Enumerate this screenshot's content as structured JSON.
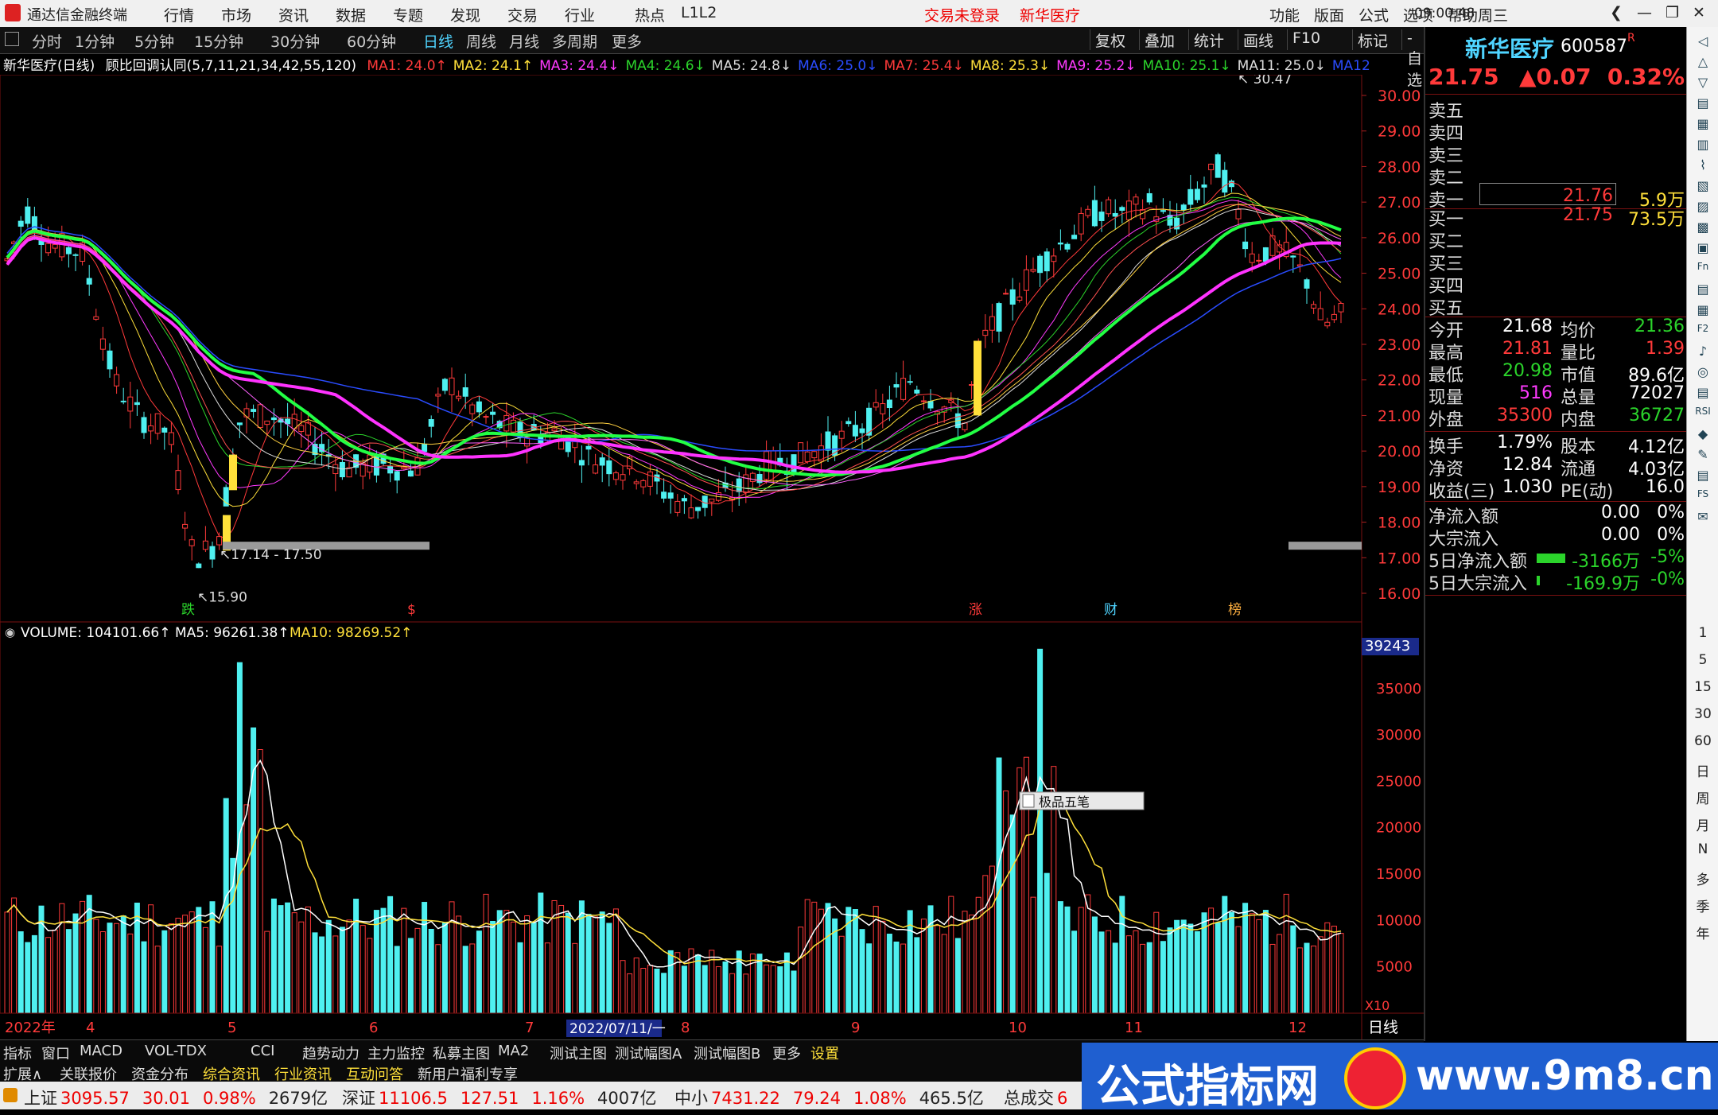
{
  "window": {
    "app_title": "通达信金融终端",
    "menu": [
      "行情",
      "市场",
      "资讯",
      "数据",
      "专题",
      "发现",
      "交易",
      "行业",
      "热点",
      "L1L2"
    ],
    "notice": "交易未登录",
    "stock_name_top": "新华医疗",
    "right_menu": [
      "功能",
      "版面",
      "公式",
      "选项",
      "帮助"
    ],
    "clock": "09:00:48",
    "weekday": "周三"
  },
  "periods": [
    "分时",
    "1分钟",
    "5分钟",
    "15分钟",
    "30分钟",
    "60分钟",
    "日线",
    "周线",
    "月线",
    "多周期",
    "更多"
  ],
  "active_period": "日线",
  "chart_tools": [
    "复权",
    "叠加",
    "统计",
    "画线",
    "F10",
    "标记",
    "-自选",
    "返回"
  ],
  "legend": {
    "title": "新华医疗(日线)",
    "indicator": "顾比回调认同(5,7,11,21,34,42,55,120)",
    "items": [
      {
        "text": "MA1: 24.0↑",
        "color": "#ff3a3a"
      },
      {
        "text": "MA2: 24.1↑",
        "color": "#ffe03a"
      },
      {
        "text": "MA3: 24.4↓",
        "color": "#ff3aff"
      },
      {
        "text": "MA4: 24.6↓",
        "color": "#2bd42b"
      },
      {
        "text": "MA5: 24.8↓",
        "color": "#dddddd"
      },
      {
        "text": "MA6: 25.0↓",
        "color": "#2a4cff"
      },
      {
        "text": "MA7: 25.4↓",
        "color": "#ff3a3a"
      },
      {
        "text": "MA8: 25.3↓",
        "color": "#ffe03a"
      },
      {
        "text": "MA9: 25.2↓",
        "color": "#ff3aff"
      },
      {
        "text": "MA10: 25.1↓",
        "color": "#2bd42b"
      },
      {
        "text": "MA11: 25.0↓",
        "color": "#dddddd"
      },
      {
        "text": "MA12",
        "color": "#2a4cff"
      }
    ]
  },
  "price_axis": [
    "30.00",
    "29.00",
    "28.00",
    "27.00",
    "26.00",
    "25.00",
    "24.00",
    "23.00",
    "22.00",
    "21.00",
    "20.00",
    "19.00",
    "18.00",
    "17.00",
    "16.00"
  ],
  "annotations": {
    "high_label": "30.47",
    "low_label": "15.90",
    "range_label": "17.14 - 17.50",
    "markers": [
      "跌",
      "$",
      "涨",
      "财",
      "榜"
    ]
  },
  "volume_legend": {
    "vol": "VOLUME: 104101.66↑",
    "ma5": "MA5: 96261.38↑",
    "ma10": "MA10: 98269.52↑"
  },
  "volume_axis": [
    "39243",
    "35000",
    "30000",
    "25000",
    "20000",
    "15000",
    "10000",
    "5000"
  ],
  "volume_unit": "X10",
  "popup_label": "极品五笔",
  "date_axis": [
    "2022年",
    "4",
    "5",
    "6",
    "7",
    "8",
    "9",
    "10",
    "11",
    "12"
  ],
  "date_cursor": "2022/07/11/一",
  "period_label": "日线",
  "bottom_tabs": [
    "指标",
    "窗口",
    "MACD",
    "VOL-TDX",
    "CCI",
    "趋势动力",
    "主力监控",
    "私募主图",
    "MA2",
    "测试主图",
    "测试幅图A",
    "测试幅图B",
    "更多",
    "设置"
  ],
  "bottom_tabs2": [
    "扩展∧",
    "关联报价",
    "资金分布",
    "综合资讯",
    "行业资讯",
    "互动问答",
    "新用户福利专享"
  ],
  "ticker": [
    {
      "name": "上证",
      "price": "3095.57",
      "chg": "30.01",
      "pct": "0.98%",
      "amt": "2679亿"
    },
    {
      "name": "深证",
      "price": "11106.5",
      "chg": "127.51",
      "pct": "1.16%",
      "amt": "4007亿"
    },
    {
      "name": "中小",
      "price": "7431.22",
      "chg": "79.24",
      "pct": "1.08%",
      "amt": "465.5亿"
    },
    {
      "name": "总成交",
      "price": "6",
      "chg": "",
      "pct": "",
      "amt": ""
    }
  ],
  "quote": {
    "name": "新华医疗",
    "code": "600587",
    "r_badge": "R",
    "price": "21.75",
    "change": "▲0.07",
    "pct": "0.32%",
    "asks": [
      {
        "label": "卖五",
        "price": "",
        "vol": ""
      },
      {
        "label": "卖四",
        "price": "",
        "vol": ""
      },
      {
        "label": "卖三",
        "price": "",
        "vol": ""
      },
      {
        "label": "卖二",
        "price": "",
        "vol": ""
      },
      {
        "label": "卖一",
        "price": "21.76",
        "vol": "5.9万"
      }
    ],
    "bids": [
      {
        "label": "买一",
        "price": "21.75",
        "vol": "73.5万"
      },
      {
        "label": "买二",
        "price": "",
        "vol": ""
      },
      {
        "label": "买三",
        "price": "",
        "vol": ""
      },
      {
        "label": "买四",
        "price": "",
        "vol": ""
      },
      {
        "label": "买五",
        "price": "",
        "vol": ""
      }
    ],
    "stats": [
      {
        "l1": "今开",
        "v1": "21.68",
        "c1": "white",
        "l2": "均价",
        "v2": "21.36",
        "c2": "green"
      },
      {
        "l1": "最高",
        "v1": "21.81",
        "c1": "red",
        "l2": "量比",
        "v2": "1.39",
        "c2": "red"
      },
      {
        "l1": "最低",
        "v1": "20.98",
        "c1": "green",
        "l2": "市值",
        "v2": "89.6亿",
        "c2": "white"
      },
      {
        "l1": "现量",
        "v1": "516",
        "c1": "mag",
        "l2": "总量",
        "v2": "72027",
        "c2": "white"
      },
      {
        "l1": "外盘",
        "v1": "35300",
        "c1": "red",
        "l2": "内盘",
        "v2": "36727",
        "c2": "green"
      }
    ],
    "stats2": [
      {
        "l1": "换手",
        "v1": "1.79%",
        "l2": "股本",
        "v2": "4.12亿"
      },
      {
        "l1": "净资",
        "v1": "12.84",
        "l2": "流通",
        "v2": "4.03亿"
      },
      {
        "l1": "收益(三)",
        "v1": "1.030",
        "l2": "PE(动)",
        "v2": "16.0"
      }
    ],
    "flows": [
      {
        "label": "净流入额",
        "v": "0.00",
        "p": "0%",
        "c": "white"
      },
      {
        "label": "大宗流入",
        "v": "0.00",
        "p": "0%",
        "c": "white"
      },
      {
        "label": "5日净流入额",
        "v": "-3166万",
        "p": "-5%",
        "c": "green"
      },
      {
        "label": "5日大宗流入",
        "v": "-169.9万",
        "p": "-0%",
        "c": "green"
      }
    ]
  },
  "sidebar_periods": [
    "1",
    "5",
    "15",
    "30",
    "60",
    "日",
    "周",
    "月",
    "N",
    "多",
    "季",
    "年"
  ],
  "watermark": {
    "left": "公式指标网",
    "right": "www.9m8.cn"
  }
}
